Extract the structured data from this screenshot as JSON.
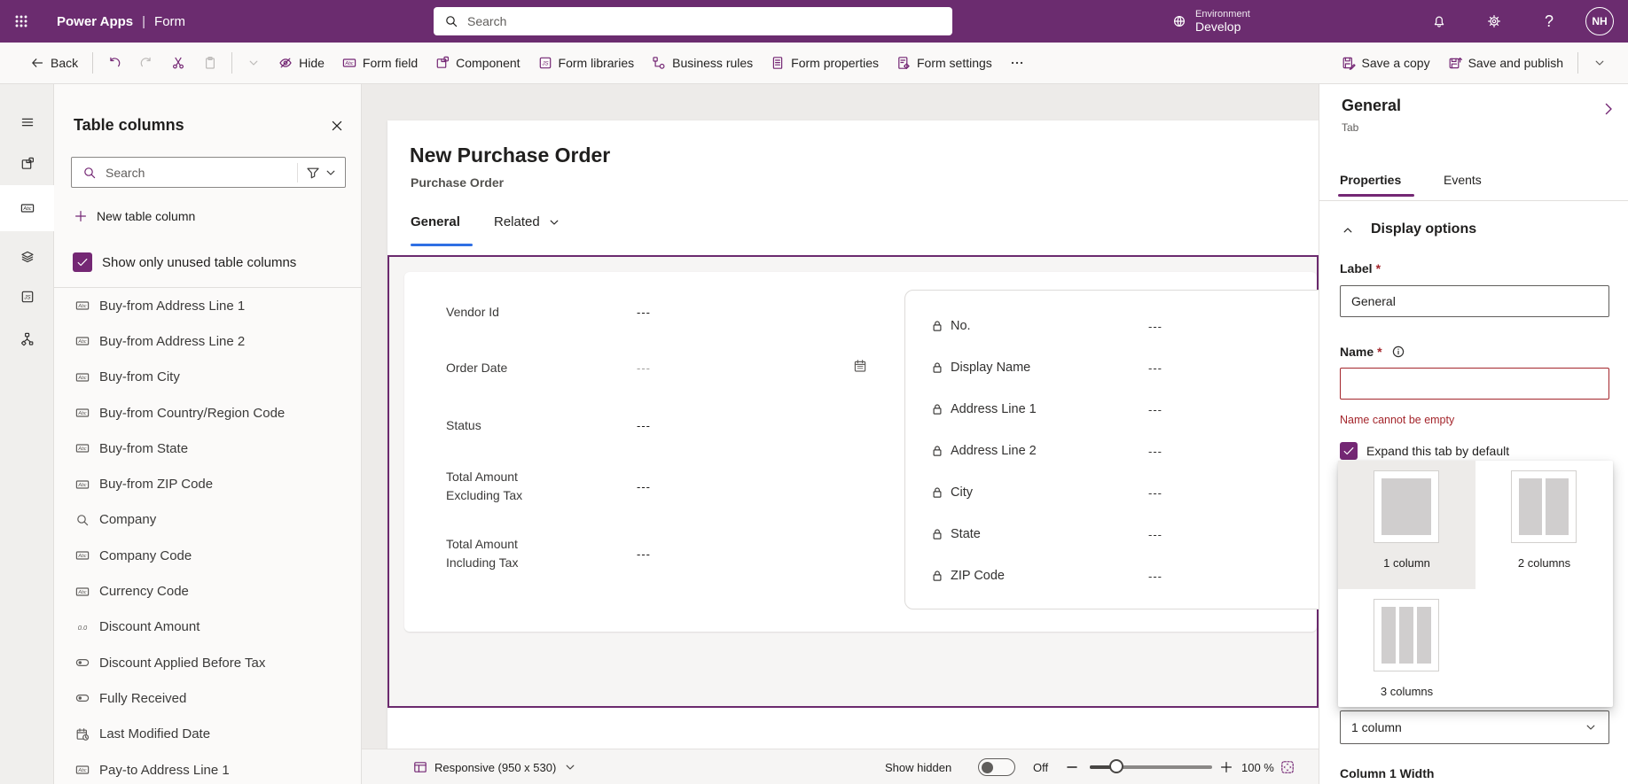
{
  "colors": {
    "accent": "#742774",
    "header_bar": "#6b2c6f",
    "canvas_tab_underline": "#2f6fe4",
    "error": "#a4262c",
    "selection_border": "#6b2a6e"
  },
  "topbar": {
    "app_name": "Power Apps",
    "divider": "|",
    "doc_name": "Form",
    "search_placeholder": "Search",
    "environment_label": "Environment",
    "environment_name": "Develop",
    "avatar_initials": "NH"
  },
  "cmdbar": {
    "back": "Back",
    "hide": "Hide",
    "form_field": "Form field",
    "component": "Component",
    "form_libraries": "Form libraries",
    "business_rules": "Business rules",
    "form_properties": "Form properties",
    "form_settings": "Form settings",
    "overflow": "more",
    "save_a_copy": "Save a copy",
    "save_and_publish": "Save and publish"
  },
  "left_panel": {
    "title": "Table columns",
    "search_placeholder": "Search",
    "new_table_column": "New table column",
    "show_only_unused": "Show only unused table columns",
    "columns": [
      {
        "label": "Buy-from Address Line 1",
        "type": "text"
      },
      {
        "label": "Buy-from Address Line 2",
        "type": "text"
      },
      {
        "label": "Buy-from City",
        "type": "text"
      },
      {
        "label": "Buy-from Country/Region Code",
        "type": "text"
      },
      {
        "label": "Buy-from State",
        "type": "text"
      },
      {
        "label": "Buy-from ZIP Code",
        "type": "text"
      },
      {
        "label": "Company",
        "type": "lookup"
      },
      {
        "label": "Company Code",
        "type": "text"
      },
      {
        "label": "Currency Code",
        "type": "text"
      },
      {
        "label": "Discount Amount",
        "type": "decimal"
      },
      {
        "label": "Discount Applied Before Tax",
        "type": "boolean"
      },
      {
        "label": "Fully Received",
        "type": "boolean"
      },
      {
        "label": "Last Modified Date",
        "type": "datetime"
      },
      {
        "label": "Pay-to Address Line 1",
        "type": "text"
      }
    ]
  },
  "canvas": {
    "form_title": "New Purchase Order",
    "form_subtitle": "Purchase Order",
    "tab_general": "General",
    "tab_related": "Related",
    "empty_value": "---",
    "left_fields": [
      {
        "label": "Vendor Id",
        "value": "---",
        "date": false,
        "dim": false
      },
      {
        "label": "Order Date",
        "value": "---",
        "date": true,
        "dim": true
      },
      {
        "label": "Status",
        "value": "---",
        "date": false,
        "dim": false
      },
      {
        "label": "Total Amount Excluding Tax",
        "value": "---",
        "date": false,
        "dim": false
      },
      {
        "label": "Total Amount Including Tax",
        "value": "---",
        "date": false,
        "dim": false
      }
    ],
    "locked_fields": [
      {
        "label": "No.",
        "value": "---"
      },
      {
        "label": "Display Name",
        "value": "---"
      },
      {
        "label": "Address Line 1",
        "value": "---"
      },
      {
        "label": "Address Line 2",
        "value": "---"
      },
      {
        "label": "City",
        "value": "---"
      },
      {
        "label": "State",
        "value": "---"
      },
      {
        "label": "ZIP Code",
        "value": "---"
      }
    ]
  },
  "statusbar": {
    "responsive_label": "Responsive (950 x 530)",
    "show_hidden_label": "Show hidden",
    "toggle_state": "Off",
    "zoom_level": "100 %"
  },
  "right_panel": {
    "title": "General",
    "subtitle": "Tab",
    "tab_properties": "Properties",
    "tab_events": "Events",
    "section_title": "Display options",
    "label_field": {
      "label": "Label",
      "required_mark": "*",
      "value": "General"
    },
    "name_field": {
      "label": "Name",
      "required_mark": "*",
      "value": "",
      "error": "Name cannot be empty"
    },
    "expand_checkbox_label": "Expand this tab by default",
    "columns_flyout": {
      "options": [
        {
          "label": "1 column",
          "cols": 1,
          "selected": true
        },
        {
          "label": "2 columns",
          "cols": 2,
          "selected": false
        },
        {
          "label": "3 columns",
          "cols": 3,
          "selected": false
        }
      ]
    },
    "columns_select_value": "1 column",
    "column_width_label": "Column 1 Width"
  },
  "icons": {
    "waffle": "app launcher 3x3 dots",
    "search": "magnifier",
    "globe": "environment globe",
    "bell": "notifications",
    "gear": "settings",
    "help": "?",
    "back": "left arrow",
    "undo": "curved arrow left",
    "redo": "curved arrow right",
    "cut": "scissors",
    "paste": "clipboard",
    "hide": "crossed-out eye",
    "abc": "Abc text field box",
    "component": "overlapping squares",
    "js": "JS box",
    "bizrules": "flowchart nodes",
    "doclines": "document with lines",
    "docgear": "document with gear",
    "ellipsis": "three dots",
    "savecopy": "save with pencil",
    "savepublish": "save with arrow",
    "hamburger": "menu lines",
    "layers": "stacked layers",
    "tree": "hierarchy nodes",
    "close": "X",
    "plus": "+",
    "funnel": "filter funnel",
    "check": "checkmark",
    "lock": "padlock",
    "calendar": "calendar",
    "calclock": "calendar with clock",
    "decimal": "0.0",
    "bool": "toggle pill",
    "monitor": "responsive screen",
    "minus": "-",
    "fit": "fit to screen",
    "info": "info circle",
    "chevdown": "chevron down",
    "chevup": "chevron up",
    "chevright": "chevron right"
  }
}
